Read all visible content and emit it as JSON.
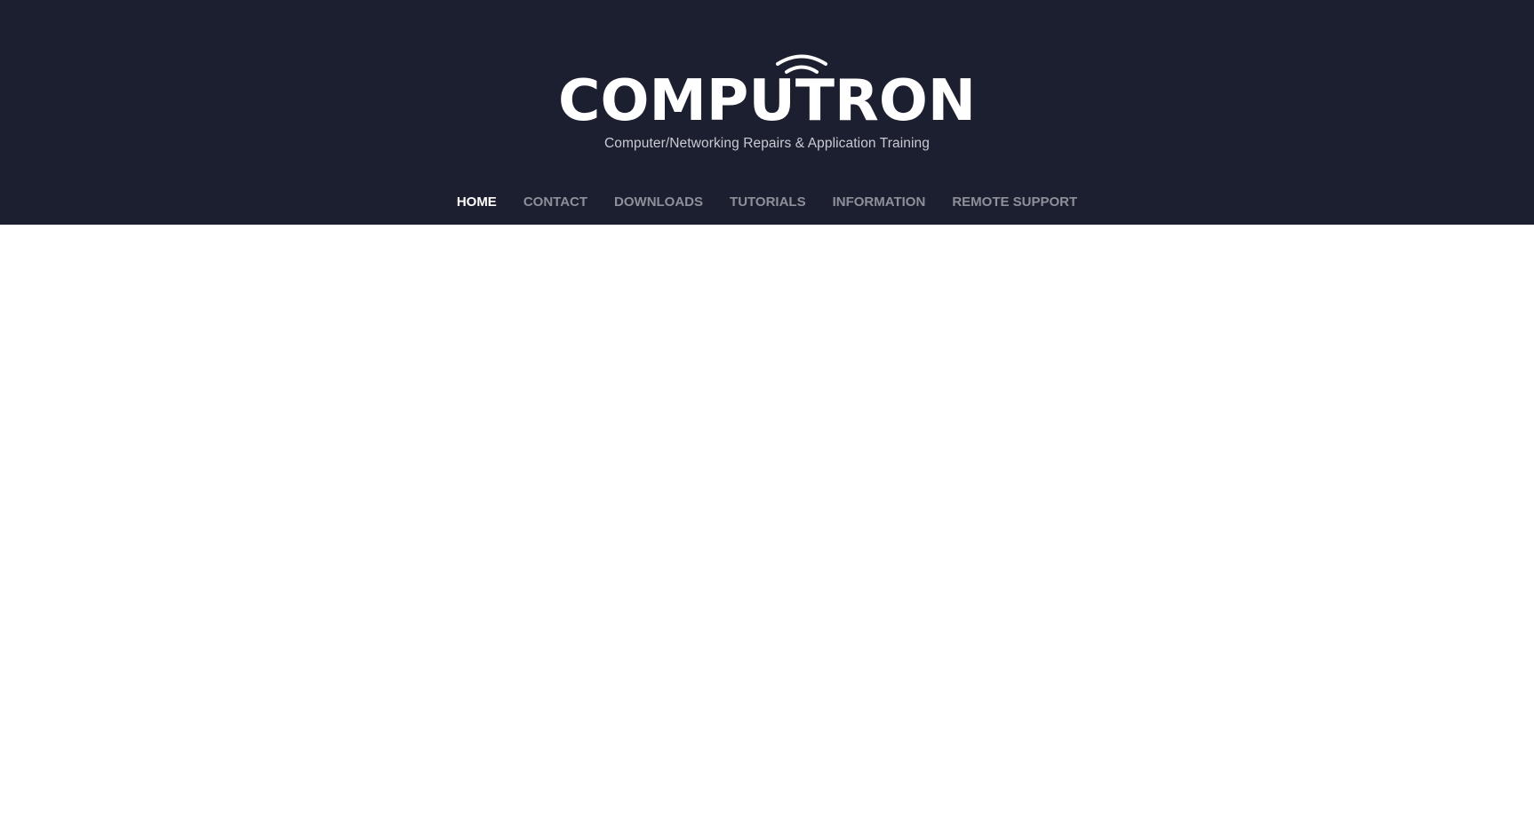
{
  "header": {
    "logo_text": "COMPUTRON",
    "tagline": "Computer/Networking Repairs & Application Training",
    "background_color": "#1c1f30"
  },
  "nav": {
    "active_color": "#ffffff",
    "inactive_color": "#8d8f99",
    "items": [
      {
        "label": "HOME",
        "active": true
      },
      {
        "label": "CONTACT",
        "active": false
      },
      {
        "label": "DOWNLOADS",
        "active": false
      },
      {
        "label": "TUTORIALS",
        "active": false
      },
      {
        "label": "INFORMATION",
        "active": false
      },
      {
        "label": "REMOTE SUPPORT",
        "active": false
      }
    ]
  }
}
